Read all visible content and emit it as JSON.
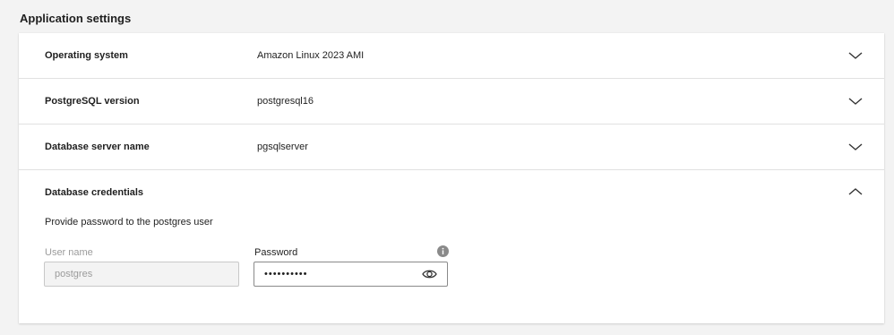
{
  "title": "Application settings",
  "rows": [
    {
      "label": "Operating system",
      "value": "Amazon Linux 2023 AMI"
    },
    {
      "label": "PostgreSQL version",
      "value": "postgresql16"
    },
    {
      "label": "Database server name",
      "value": "pgsqlserver"
    }
  ],
  "credentials": {
    "label": "Database credentials",
    "description": "Provide password to the postgres user",
    "username_label": "User name",
    "username_value": "postgres",
    "password_label": "Password",
    "password_value": "••••••••••"
  },
  "icons": {
    "collapsed": "chevron-down-icon",
    "expanded": "chevron-up-icon",
    "info": "info-icon",
    "reveal": "eye-icon"
  }
}
